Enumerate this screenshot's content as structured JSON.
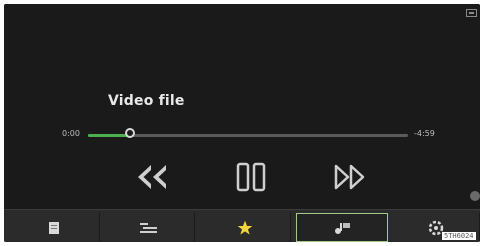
{
  "player": {
    "title": "Video file",
    "elapsed": "0:00",
    "remaining": "-4:59",
    "progress": 0.13,
    "controls": {
      "rewind_icon": "rewind-icon",
      "pause_icon": "pause-icon",
      "forward_icon": "fast-forward-icon"
    }
  },
  "bottom_tabs": [
    {
      "icon": "document-icon",
      "active": false
    },
    {
      "icon": "list-icon",
      "active": false
    },
    {
      "icon": "star-icon",
      "active": false
    },
    {
      "icon": "music-source-icon",
      "active": true
    },
    {
      "icon": "settings-icon",
      "active": false
    }
  ],
  "watermark": "5TH6024",
  "colors": {
    "progress_fill": "#4caf50",
    "star": "#f2d43c",
    "active_tab_border": "#a6c98a"
  }
}
